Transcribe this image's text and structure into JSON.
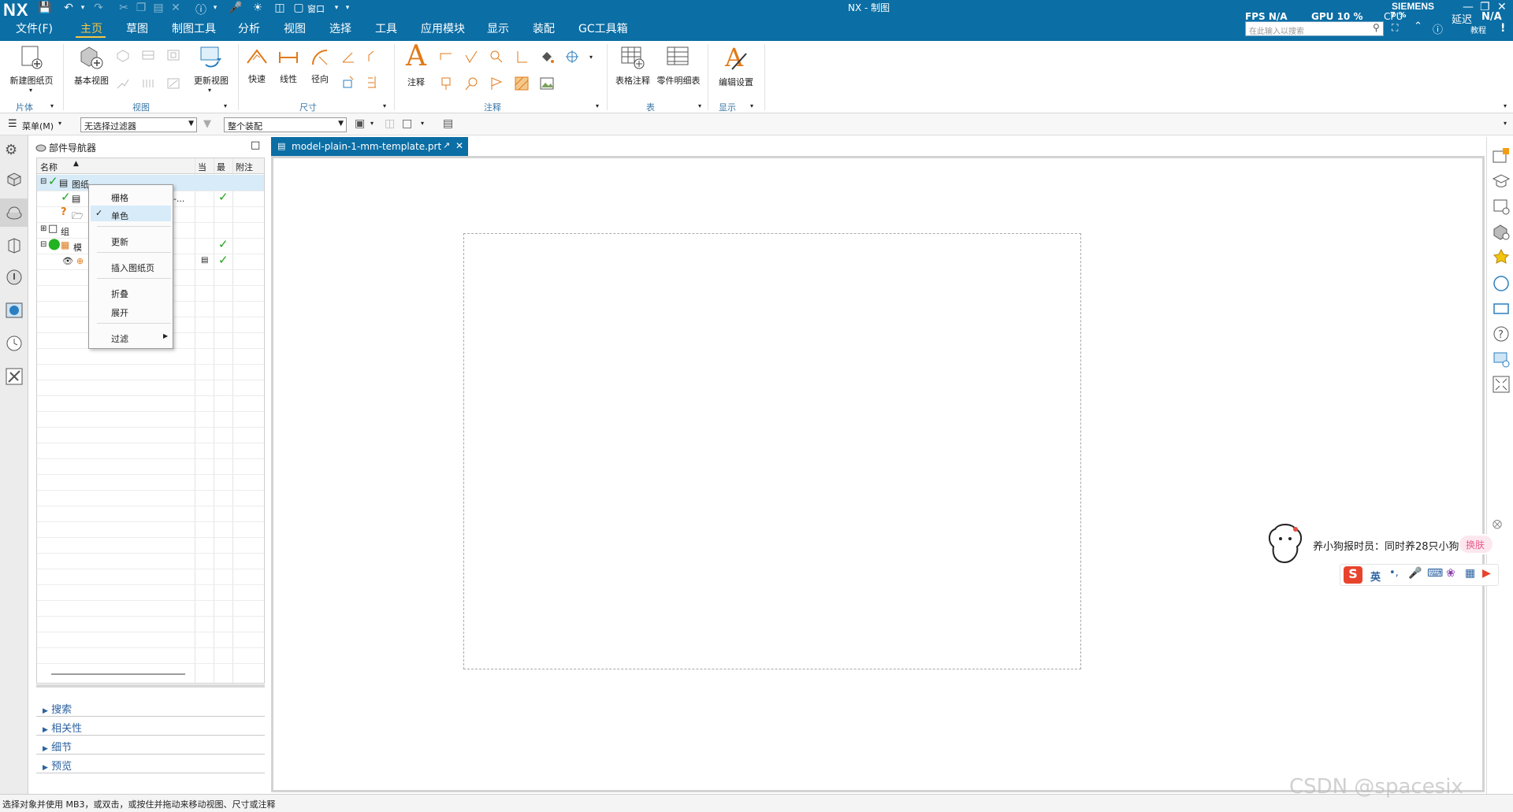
{
  "app": {
    "logo": "NX",
    "window_title": "NX - 制图",
    "brand": "SIEMENS",
    "colors": {
      "titlebar": "#0b6ea5",
      "active_menu": "#f6c744",
      "group_label": "#3a77a6",
      "check": "#1aa51a"
    }
  },
  "menubar": {
    "items": [
      "文件(F)",
      "主页",
      "草图",
      "制图工具",
      "分析",
      "视图",
      "选择",
      "工具",
      "应用模块",
      "显示",
      "装配",
      "GC工具箱"
    ],
    "active": "主页"
  },
  "quick_access": {
    "window_label": "窗口"
  },
  "stats": {
    "fps_label": "FPS",
    "fps_value": "N/A",
    "gpu_label": "GPU",
    "gpu_value": "10 %",
    "cpu_label": "CPU",
    "cpu_value": "7 %",
    "latency_label": "延迟",
    "latency_value": "N/A",
    "tutorial_label": "教程"
  },
  "search": {
    "placeholder": "在此输入以搜索"
  },
  "ribbon": {
    "buttons": {
      "new_sheet": "新建图纸页",
      "base_view": "基本视图",
      "update_view": "更新视图",
      "quick_dim": "快速",
      "linear_dim": "线性",
      "radial_dim": "径向",
      "note": "注释",
      "table_note": "表格注释",
      "parts_list": "零件明细表",
      "edit_settings": "编辑设置"
    },
    "groups": {
      "sheet": "片体",
      "view": "视图",
      "dimension": "尺寸",
      "annotation": "注释",
      "table": "表",
      "display": "显示"
    }
  },
  "toolbar": {
    "menu_label": "菜单(M)",
    "filter_value": "无选择过滤器",
    "scope_value": "整个装配"
  },
  "navigator": {
    "title": "部件导航器",
    "columns": {
      "name": "名称",
      "current": "当",
      "latest": "最",
      "notes": "附注"
    },
    "rows": [
      {
        "label": "图纸"
      },
      {
        "label": "E-..."
      },
      {
        "label": "组"
      },
      {
        "label": "模"
      }
    ],
    "panels": [
      "搜索",
      "相关性",
      "细节",
      "预览"
    ]
  },
  "context_menu": {
    "items": [
      "栅格",
      "单色",
      "更新",
      "插入图纸页",
      "折叠",
      "展开",
      "过滤"
    ],
    "checked": "单色"
  },
  "document": {
    "tab_label": "model-plain-1-mm-template.prt"
  },
  "status": {
    "text": "选择对象并使用 MB3，或双击，或按住并拖动来移动视图、尺寸或注释"
  },
  "ime": {
    "notice": "养小狗报时员：同时养28只小狗",
    "skin_button": "换肤",
    "lang": "英"
  },
  "watermark": "CSDN @spacesix"
}
